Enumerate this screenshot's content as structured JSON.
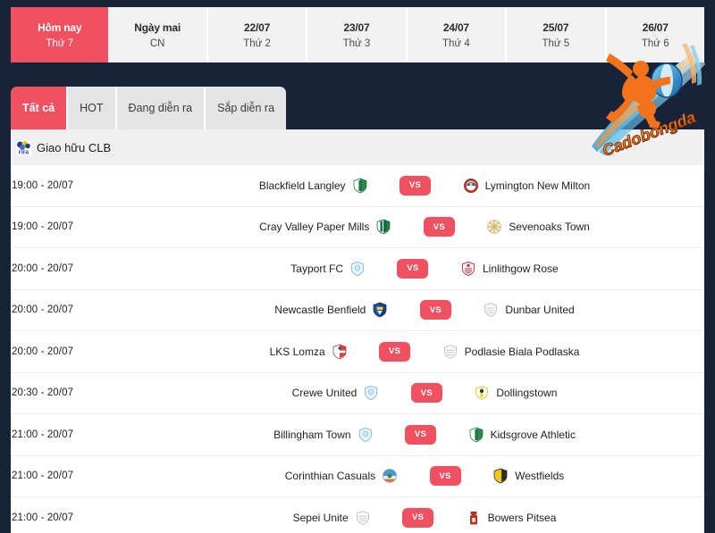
{
  "theme": {
    "background": "#18233a",
    "accent": "#ef5160",
    "panel": "#ffffff",
    "header_cell": "#f2f2f2",
    "league_band": "#f0f0f0"
  },
  "date_strip": [
    {
      "top": "Hôm nay",
      "bottom": "Thứ 7",
      "active": true
    },
    {
      "top": "Ngày mai",
      "bottom": "CN",
      "active": false
    },
    {
      "top": "22/07",
      "bottom": "Thứ 2",
      "active": false
    },
    {
      "top": "23/07",
      "bottom": "Thứ 3",
      "active": false
    },
    {
      "top": "24/07",
      "bottom": "Thứ 4",
      "active": false
    },
    {
      "top": "25/07",
      "bottom": "Thứ 5",
      "active": false
    },
    {
      "top": "26/07",
      "bottom": "Thứ 6",
      "active": false
    }
  ],
  "tabs": [
    {
      "label": "Tất cả",
      "active": true
    },
    {
      "label": "HOT",
      "active": false
    },
    {
      "label": "Đang diễn ra",
      "active": false
    },
    {
      "label": "Sắp diễn ra",
      "active": false
    }
  ],
  "league": {
    "name": "Giao hữu CLB",
    "icon": "fifa-icon"
  },
  "vs_label": "VS",
  "watermark": {
    "text": "Cadobongda",
    "icon": "soccer-player-logo"
  },
  "matches": [
    {
      "time": "19:00",
      "date": "20/07",
      "separator": "-",
      "home": "Blackfield Langley",
      "away": "Lymington New Milton",
      "home_crest": "green-white-shield-crest",
      "away_crest": "red-blue-roundel-crest"
    },
    {
      "time": "19:00",
      "date": "20/07",
      "separator": "-",
      "home": "Cray Valley Paper Mills",
      "away": "Sevenoaks Town",
      "home_crest": "green-white-vertical-crest",
      "away_crest": "gold-starburst-crest"
    },
    {
      "time": "20:00",
      "date": "20/07",
      "separator": "-",
      "home": "Tayport FC",
      "away": "Linlithgow Rose",
      "home_crest": "pale-blue-shield-crest",
      "away_crest": "maroon-ornate-crest"
    },
    {
      "time": "20:00",
      "date": "20/07",
      "separator": "-",
      "home": "Newcastle Benfield",
      "away": "Dunbar United",
      "home_crest": "blue-gold-shield-crest",
      "away_crest": "grey-outline-crest"
    },
    {
      "time": "20:00",
      "date": "20/07",
      "separator": "-",
      "home": "LKS Lomza",
      "away": "Podlasie Biala Podlaska",
      "home_crest": "red-white-shield-crest",
      "away_crest": "grey-outline-crest"
    },
    {
      "time": "20:30",
      "date": "20/07",
      "separator": "-",
      "home": "Crewe United",
      "away": "Dollingstown",
      "home_crest": "pale-blue-shield-crest",
      "away_crest": "yellow-black-crest"
    },
    {
      "time": "21:00",
      "date": "20/07",
      "separator": "-",
      "home": "Billingham Town",
      "away": "Kidsgrove Athletic",
      "home_crest": "pale-blue-shield-crest",
      "away_crest": "green-white-shield-crest"
    },
    {
      "time": "21:00",
      "date": "20/07",
      "separator": "-",
      "home": "Corinthian Casuals",
      "away": "Westfields",
      "home_crest": "multicolor-globe-crest",
      "away_crest": "yellow-black-shield-crest"
    },
    {
      "time": "21:00",
      "date": "20/07",
      "separator": "-",
      "home": "Sepei Unite",
      "away": "Bowers Pitsea",
      "home_crest": "grey-outline-crest",
      "away_crest": "red-tower-crest"
    }
  ]
}
